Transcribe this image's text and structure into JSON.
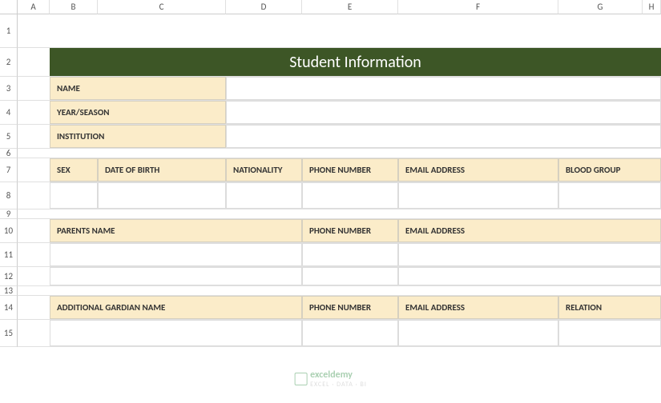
{
  "columns": [
    "",
    "A",
    "B",
    "C",
    "D",
    "E",
    "F",
    "G",
    "H"
  ],
  "rows": [
    "1",
    "2",
    "3",
    "4",
    "5",
    "6",
    "7",
    "8",
    "9",
    "10",
    "11",
    "12",
    "13",
    "14",
    "15"
  ],
  "title": "Student Information",
  "section1": {
    "name": "NAME",
    "year": "YEAR/SEASON",
    "institution": "INSTITUTION"
  },
  "section2": {
    "sex": "SEX",
    "dob": "DATE OF BIRTH",
    "nationality": "NATIONALITY",
    "phone": "PHONE NUMBER",
    "email": "EMAIL ADDRESS",
    "blood": "BLOOD GROUP"
  },
  "section3": {
    "parent": "PARENTS NAME",
    "phone": "PHONE NUMBER",
    "email": "EMAIL ADDRESS"
  },
  "section4": {
    "guardian": "ADDITIONAL GARDIAN NAME",
    "phone": "PHONE NUMBER",
    "email": "EMAIL ADDRESS",
    "relation": "RELATION"
  },
  "watermark": {
    "brand": "exceldemy",
    "sub": "EXCEL · DATA · BI"
  }
}
